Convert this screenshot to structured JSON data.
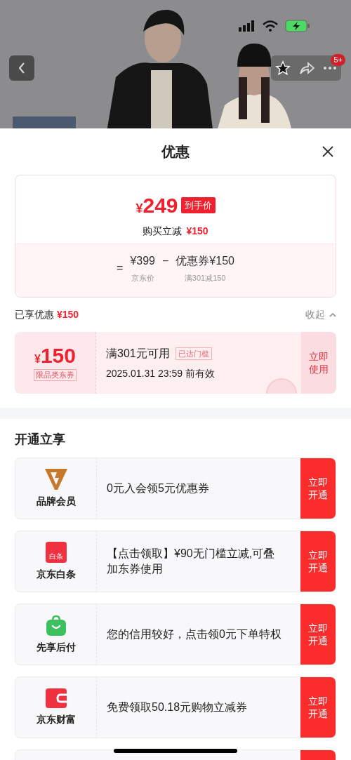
{
  "nav": {
    "badge": "5+"
  },
  "sheet": {
    "title": "优惠"
  },
  "price_card": {
    "currency": "¥",
    "final_price": "249",
    "price_tag": "到手价",
    "discount_label": "购买立减",
    "discount_amount": "¥150",
    "equals": "=",
    "original_price": "¥399",
    "minus": "−",
    "coupon_price": "优惠券¥150",
    "original_label": "京东价",
    "coupon_label": "满301减150"
  },
  "enjoyed": {
    "label": "已享优惠",
    "amount": "¥150",
    "toggle": "收起",
    "expanded": true
  },
  "coupons": [
    {
      "currency": "¥",
      "amount": "150",
      "category": "限品类东券",
      "condition": "满301元可用",
      "status_tag": "已达门槛",
      "validity": "2025.01.31 23:59 前有效",
      "action": "立即使用"
    }
  ],
  "section_title": "开通立享",
  "offers": [
    {
      "kind": "member",
      "name": "品牌会员",
      "description": "0元入会领5元优惠券",
      "action": "立即开通"
    },
    {
      "kind": "baitiao",
      "icon_text": "白条",
      "name": "京东白条",
      "description": "【点击领取】¥90无门槛立减,可叠加东券使用",
      "action": "立即开通"
    },
    {
      "kind": "pay_later",
      "name": "先享后付",
      "description": "您的信用较好，点击领0元下单特权",
      "action": "立即开通"
    },
    {
      "kind": "wealth",
      "name": "京东财富",
      "description": "免费领取50.18元购物立减券",
      "action": "立即开通"
    }
  ]
}
